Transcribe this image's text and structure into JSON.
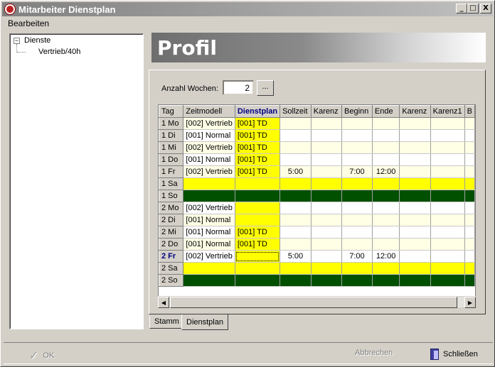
{
  "window": {
    "title": "Mitarbeiter Dienstplan",
    "min_label": "_",
    "max_label": "□",
    "close_label": "X"
  },
  "menu": {
    "edit": "Bearbeiten"
  },
  "tree": {
    "root": "Dienste",
    "root_expander": "−",
    "child": "Vertrieb/40h"
  },
  "header": {
    "title": "Profil"
  },
  "weeks": {
    "label": "Anzahl Wochen:",
    "value": "2",
    "browse": "..."
  },
  "grid": {
    "columns": [
      "Tag",
      "Zeitmodell",
      "Dienstplan",
      "Sollzeit",
      "Karenz",
      "Beginn",
      "Ende",
      "Karenz",
      "Karenz1",
      "B"
    ],
    "rows": [
      {
        "tag": "1 Mo",
        "zeitmodell": "[002] Vertrieb",
        "dienstplan": "[001] TD",
        "sollzeit": "",
        "beginn": "",
        "ende": "",
        "style": "normal"
      },
      {
        "tag": "1 Di",
        "zeitmodell": "[001] Normal",
        "dienstplan": "[001] TD",
        "sollzeit": "",
        "beginn": "",
        "ende": "",
        "style": "normal"
      },
      {
        "tag": "1 Mi",
        "zeitmodell": "[002] Vertrieb",
        "dienstplan": "[001] TD",
        "sollzeit": "",
        "beginn": "",
        "ende": "",
        "style": "normal"
      },
      {
        "tag": "1 Do",
        "zeitmodell": "[001] Normal",
        "dienstplan": "[001] TD",
        "sollzeit": "",
        "beginn": "",
        "ende": "",
        "style": "normal"
      },
      {
        "tag": "1 Fr",
        "zeitmodell": "[002] Vertrieb",
        "dienstplan": "[001] TD",
        "sollzeit": "5:00",
        "beginn": "7:00",
        "ende": "12:00",
        "style": "normal"
      },
      {
        "tag": "1 Sa",
        "zeitmodell": "",
        "dienstplan": "",
        "sollzeit": "",
        "beginn": "",
        "ende": "",
        "style": "sat"
      },
      {
        "tag": "1 So",
        "zeitmodell": "",
        "dienstplan": "",
        "sollzeit": "",
        "beginn": "",
        "ende": "",
        "style": "sun"
      },
      {
        "tag": "2 Mo",
        "zeitmodell": "[002] Vertrieb",
        "dienstplan": "",
        "sollzeit": "",
        "beginn": "",
        "ende": "",
        "style": "normal"
      },
      {
        "tag": "2 Di",
        "zeitmodell": "[001] Normal",
        "dienstplan": "",
        "sollzeit": "",
        "beginn": "",
        "ende": "",
        "style": "normal"
      },
      {
        "tag": "2 Mi",
        "zeitmodell": "[001] Normal",
        "dienstplan": "[001] TD",
        "sollzeit": "",
        "beginn": "",
        "ende": "",
        "style": "normal"
      },
      {
        "tag": "2 Do",
        "zeitmodell": "[001] Normal",
        "dienstplan": "[001] TD",
        "sollzeit": "",
        "beginn": "",
        "ende": "",
        "style": "normal"
      },
      {
        "tag": "2 Fr",
        "zeitmodell": "[002] Vertrieb",
        "dienstplan": "",
        "sollzeit": "5:00",
        "beginn": "7:00",
        "ende": "12:00",
        "style": "current"
      },
      {
        "tag": "2 Sa",
        "zeitmodell": "",
        "dienstplan": "",
        "sollzeit": "",
        "beginn": "",
        "ende": "",
        "style": "sat"
      },
      {
        "tag": "2 So",
        "zeitmodell": "",
        "dienstplan": "",
        "sollzeit": "",
        "beginn": "",
        "ende": "",
        "style": "sun"
      }
    ]
  },
  "tabs": {
    "stamm": "Stamm",
    "dienstplan": "Dienstplan"
  },
  "footer": {
    "ok": "OK",
    "cancel": "Abbrechen",
    "close": "Schließen"
  },
  "colors": {
    "yellow": "#ffff00",
    "dark_green": "#005000",
    "light_row": "#ffffe6"
  }
}
